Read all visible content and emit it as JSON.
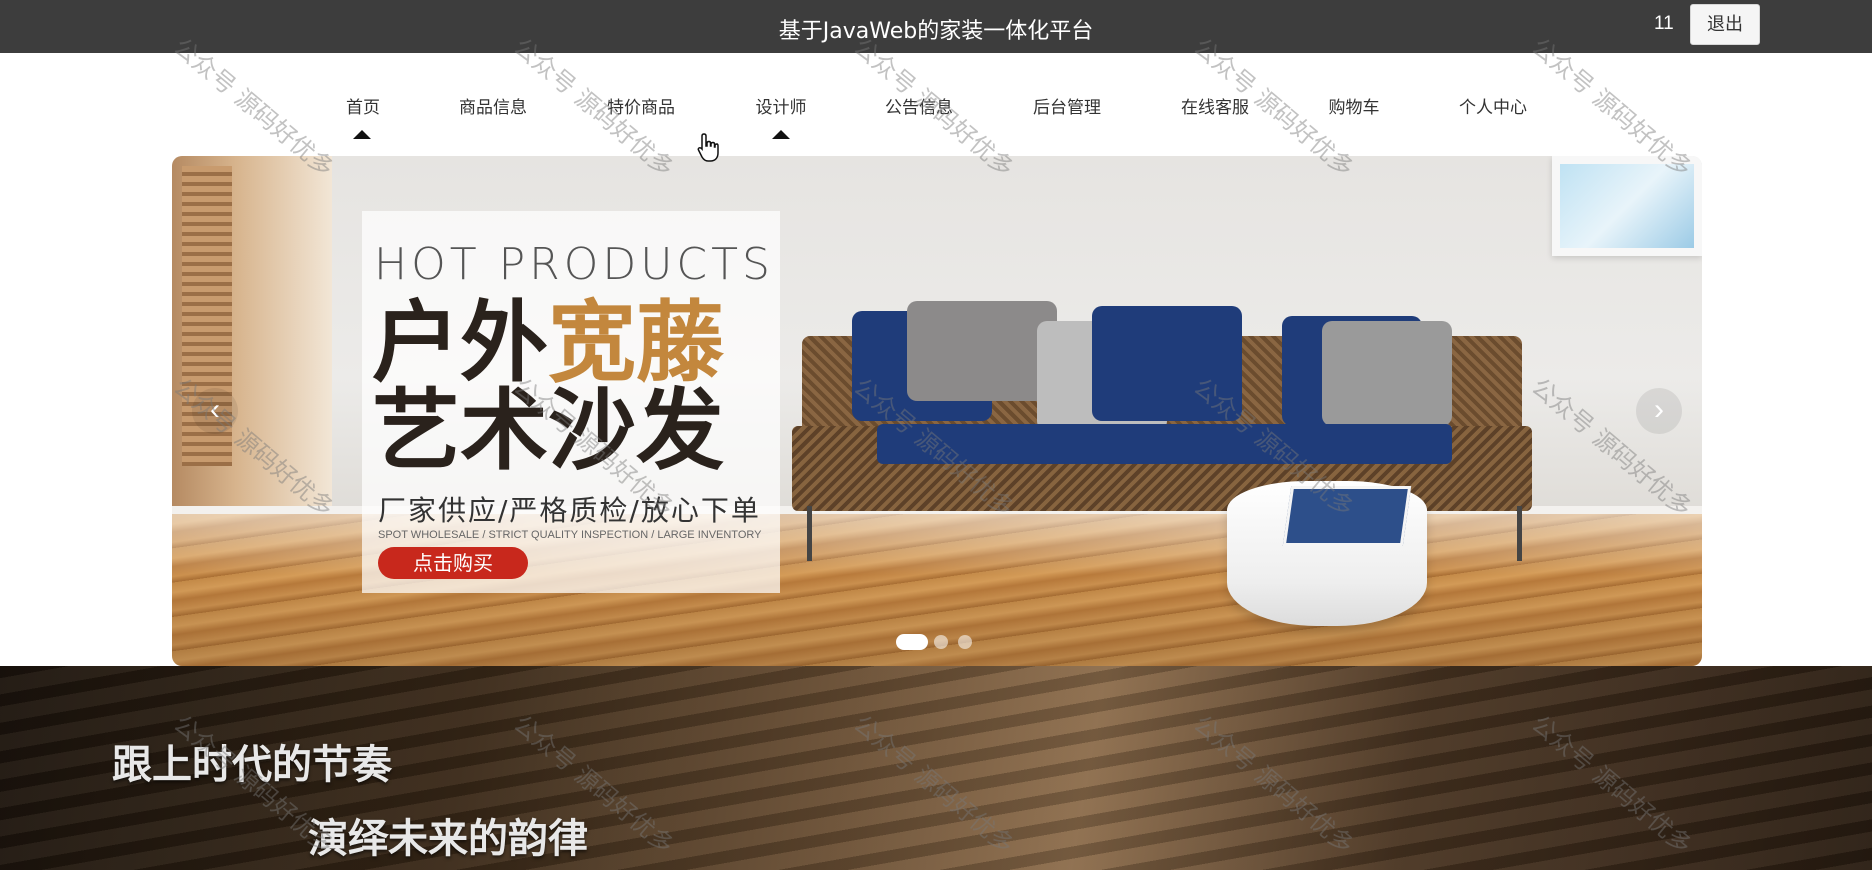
{
  "header": {
    "site_title": "基于JavaWeb的家装一体化平台",
    "user_id": "11",
    "logout_label": "退出"
  },
  "nav": {
    "items": [
      {
        "label": "首页"
      },
      {
        "label": "商品信息"
      },
      {
        "label": "特价商品"
      },
      {
        "label": "设计师"
      },
      {
        "label": "公告信息"
      },
      {
        "label": "后台管理"
      },
      {
        "label": "在线客服"
      },
      {
        "label": "购物车"
      },
      {
        "label": "个人中心"
      }
    ]
  },
  "banner": {
    "eyebrow": "HOT PRODUCTS",
    "headline_line1_a": "户外",
    "headline_line1_b": "宽藤",
    "headline_line2": "艺术沙发",
    "slogan": "厂家供应/严格质检/放心下单",
    "slogan_en": "SPOT WHOLESALE / STRICT QUALITY INSPECTION / LARGE INVENTORY",
    "button_label": "点击购买",
    "prev_arrow": "‹",
    "next_arrow": "›",
    "slide_count": 3,
    "active_slide": 1
  },
  "section": {
    "tagline_1": "跟上时代的节奏",
    "tagline_2": "演绎未来的韵律"
  },
  "watermark": {
    "text": "公众号 源码好优多"
  },
  "colors": {
    "topbar": "#3d3d3d",
    "buy_button": "#c8281c",
    "accent_text": "#c3873d",
    "sofa_blue": "#1f3c7a"
  }
}
